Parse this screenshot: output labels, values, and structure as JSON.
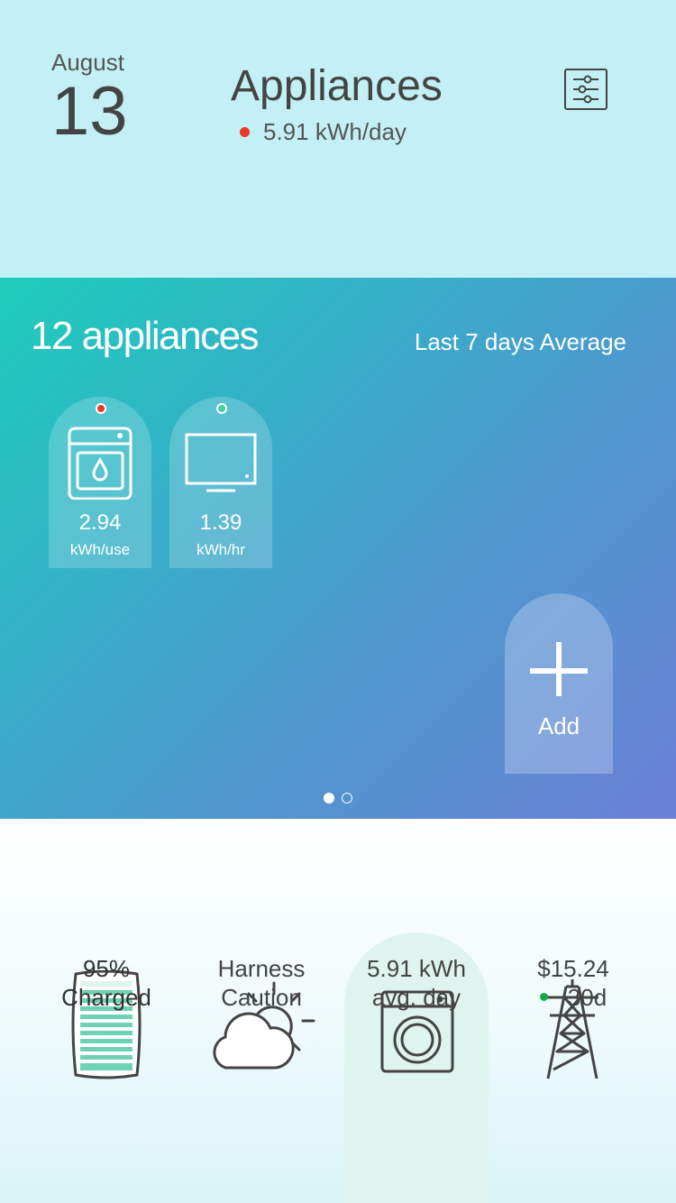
{
  "header": {
    "month": "August",
    "day": "13",
    "title": "Appliances",
    "usage": "5.91 kWh/day",
    "status_color": "#e8392a"
  },
  "panel": {
    "count_label": "12 appliances",
    "period_label": "Last 7 days Average",
    "gradient": [
      "#1ecdbb",
      "#4a9ccd",
      "#6a7fd6"
    ],
    "appliances": [
      {
        "icon": "dishwasher-icon",
        "value": "2.94",
        "unit": "kWh/use",
        "status_color": "#e8392a"
      },
      {
        "icon": "tv-icon",
        "value": "1.39",
        "unit": "kWh/hr",
        "status_color": "#3fd1a3"
      }
    ],
    "add_label": "Add",
    "pages": 2,
    "current_page": 1
  },
  "stats": [
    {
      "icon": "battery-icon",
      "line1": "95%",
      "line2": "Charged"
    },
    {
      "icon": "partly-cloudy-icon",
      "line1": "Harness",
      "line2": "Caution"
    },
    {
      "icon": "washing-machine-icon",
      "line1": "5.91 kWh",
      "line2": "avg. day",
      "highlighted": true
    },
    {
      "icon": "power-tower-icon",
      "line1": "$15.24",
      "line2": "30d",
      "status_color": "#1aa64a"
    }
  ]
}
